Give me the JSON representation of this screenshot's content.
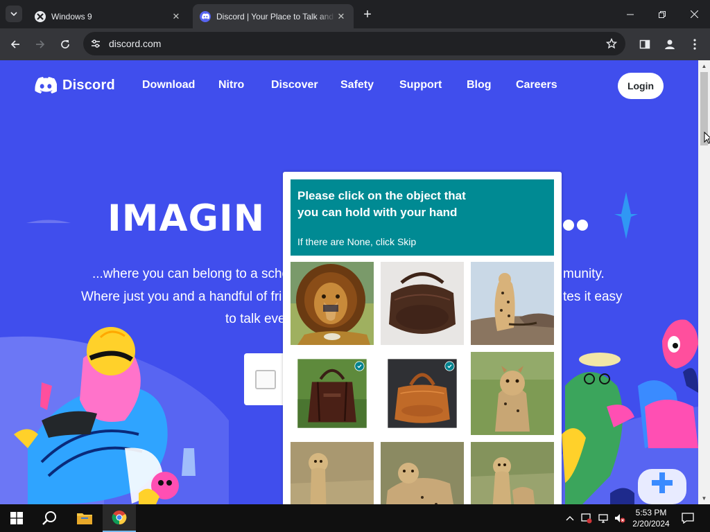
{
  "browser": {
    "tabs": [
      {
        "title": "Windows 9",
        "active": false
      },
      {
        "title": "Discord | Your Place to Talk and Hang Out",
        "active": true
      }
    ],
    "url": "discord.com"
  },
  "site": {
    "brand": "Discord",
    "nav": [
      "Download",
      "Nitro",
      "Discover",
      "Safety",
      "Support",
      "Blog",
      "Careers"
    ],
    "login_label": "Login",
    "hero_title": "IMAGIN",
    "hero_lines": [
      {
        "left": "...where you can belong to a scho",
        "right": "munity."
      },
      {
        "left": "Where just you and a handful of fri",
        "right": "tes it easy"
      },
      {
        "left": "to talk eve",
        "right": ""
      }
    ],
    "colors": {
      "blurple": "#404eed",
      "white": "#ffffff"
    }
  },
  "captcha": {
    "prompt": "Please click on the object that you can hold with your hand",
    "hint": "If there are None, click Skip",
    "header_color": "#008a93",
    "tiles": [
      {
        "name": "lion",
        "selected": false
      },
      {
        "name": "brown-leather-bag",
        "selected": false
      },
      {
        "name": "cheetah-sitting",
        "selected": false
      },
      {
        "name": "dark-leather-handbag",
        "selected": true
      },
      {
        "name": "tan-leather-handbag",
        "selected": true
      },
      {
        "name": "cheetah-cub-grass",
        "selected": false
      },
      {
        "name": "cheetah-cub-standing",
        "selected": false
      },
      {
        "name": "cheetah-lying",
        "selected": false
      },
      {
        "name": "cheetah-cubs",
        "selected": false
      }
    ]
  },
  "taskbar": {
    "time": "5:53 PM",
    "date": "2/20/2024"
  }
}
